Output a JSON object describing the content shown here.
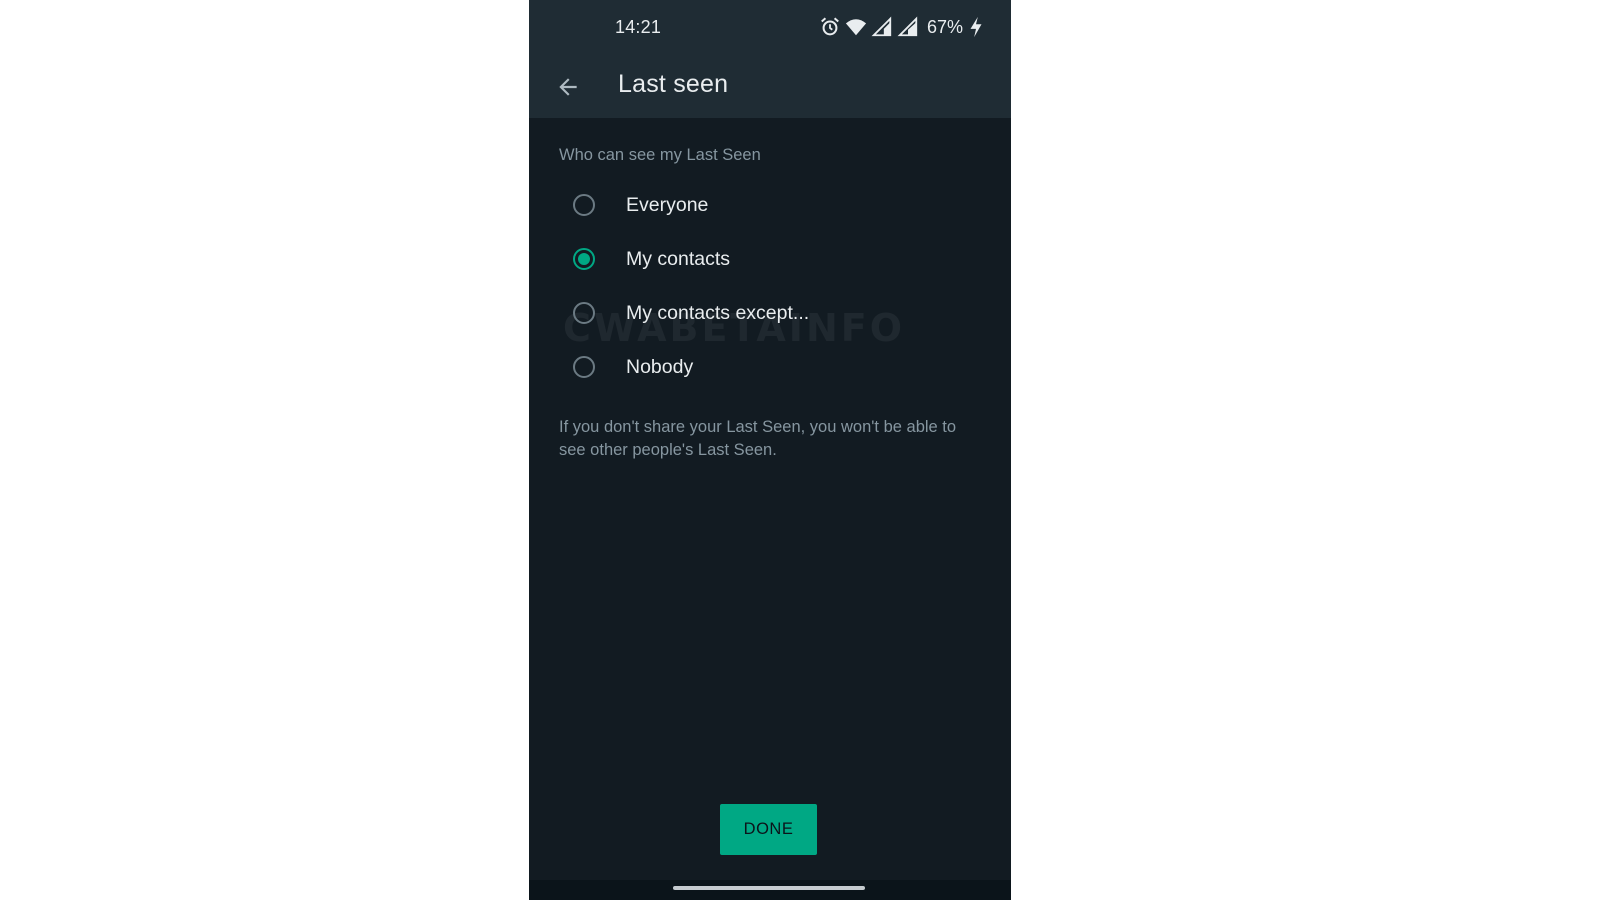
{
  "status_bar": {
    "time": "14:21",
    "battery": "67%",
    "icons": [
      "alarm-icon",
      "wifi-icon",
      "signal-icon",
      "signal-icon",
      "charging-icon"
    ]
  },
  "app_bar": {
    "back_icon": "arrow-left-icon",
    "title": "Last seen"
  },
  "section": {
    "label": "Who can see my Last Seen"
  },
  "options": [
    {
      "label": "Everyone",
      "selected": false
    },
    {
      "label": "My contacts",
      "selected": true
    },
    {
      "label": "My contacts except...",
      "selected": false
    },
    {
      "label": "Nobody",
      "selected": false
    }
  ],
  "watermark": "CWABETAINFO",
  "info_text": "If you don't share your Last Seen, you won't be able to see other people's Last Seen.",
  "done_button": {
    "label": "DONE"
  },
  "colors": {
    "accent": "#00a884",
    "background": "#121b22",
    "header": "#1f2c34",
    "primary_text": "#e9edef",
    "secondary_text": "#8696a0"
  }
}
